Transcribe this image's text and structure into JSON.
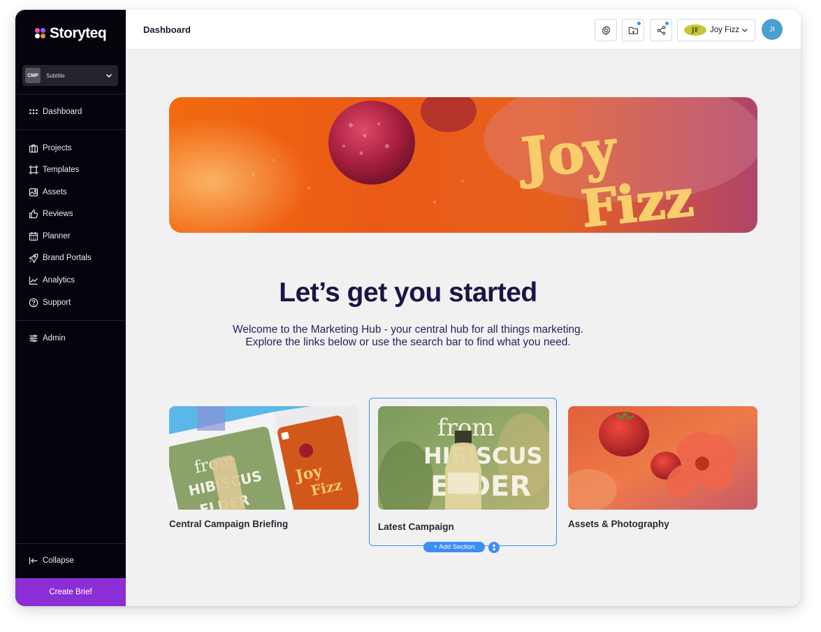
{
  "sidebar": {
    "logo_text": "Storyteq",
    "campaign": {
      "badge": "CMP",
      "subtitle": "Subtitle"
    },
    "items": [
      {
        "label": "Dashboard",
        "icon": "grid-dots-icon"
      },
      {
        "label": "Projects",
        "icon": "briefcase-icon"
      },
      {
        "label": "Templates",
        "icon": "template-icon"
      },
      {
        "label": "Assets",
        "icon": "image-icon"
      },
      {
        "label": "Reviews",
        "icon": "thumbs-up-icon"
      },
      {
        "label": "Planner",
        "icon": "calendar-icon"
      },
      {
        "label": "Brand Portals",
        "icon": "rocket-icon"
      },
      {
        "label": "Analytics",
        "icon": "line-chart-icon"
      },
      {
        "label": "Support",
        "icon": "help-circle-icon"
      },
      {
        "label": "Admin",
        "icon": "sliders-icon"
      }
    ],
    "collapse_label": "Collapse",
    "create_brief_label": "Create Brief"
  },
  "header": {
    "title": "Dashboard",
    "brand_name": "Joy Fizz",
    "avatar_initials": "JI"
  },
  "hero": {
    "brand_art": "Joy Fizz"
  },
  "main": {
    "headline": "Let’s get you started",
    "welcome_line1": "Welcome to the Marketing Hub - your central hub for all things marketing.",
    "welcome_line2": "Explore the links below or use the search bar to find what you need."
  },
  "cards": [
    {
      "label": "Central Campaign Briefing"
    },
    {
      "label": "Latest Campaign"
    },
    {
      "label": "Assets & Photography"
    }
  ],
  "card_art": {
    "from": "from",
    "hibiscus": "HIBISCUS",
    "elder": "ELDER",
    "joy": "Joy",
    "fizz": "Fizz"
  },
  "editor": {
    "add_section_label": "+ Add Section"
  },
  "colors": {
    "sidebar_bg": "#05040d",
    "accent_purple": "#8b2ed6",
    "selection_blue": "#3d8df3",
    "headline_navy": "#1e1246",
    "avatar_blue": "#4a9fd1"
  }
}
